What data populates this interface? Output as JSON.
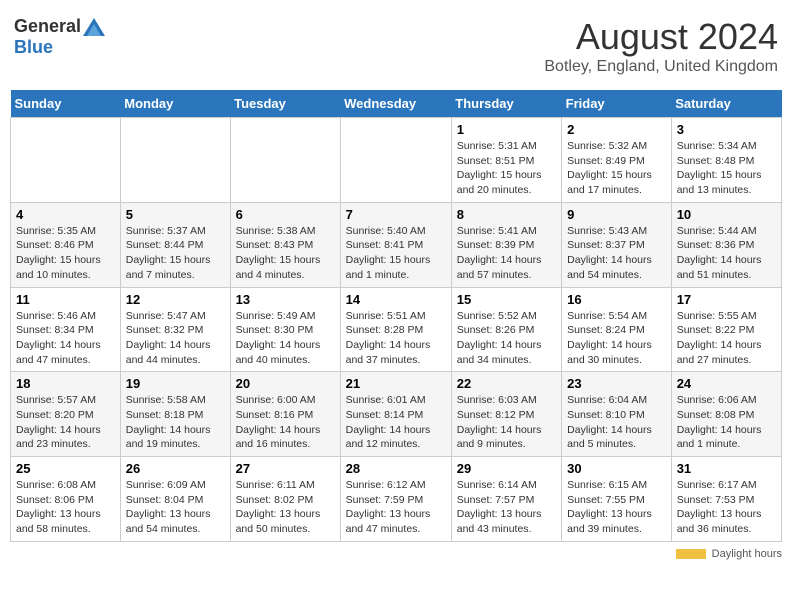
{
  "header": {
    "logo_general": "General",
    "logo_blue": "Blue",
    "title": "August 2024",
    "subtitle": "Botley, England, United Kingdom"
  },
  "days_of_week": [
    "Sunday",
    "Monday",
    "Tuesday",
    "Wednesday",
    "Thursday",
    "Friday",
    "Saturday"
  ],
  "weeks": [
    {
      "days": [
        {
          "number": "",
          "info": ""
        },
        {
          "number": "",
          "info": ""
        },
        {
          "number": "",
          "info": ""
        },
        {
          "number": "",
          "info": ""
        },
        {
          "number": "1",
          "info": "Sunrise: 5:31 AM\nSunset: 8:51 PM\nDaylight: 15 hours\nand 20 minutes."
        },
        {
          "number": "2",
          "info": "Sunrise: 5:32 AM\nSunset: 8:49 PM\nDaylight: 15 hours\nand 17 minutes."
        },
        {
          "number": "3",
          "info": "Sunrise: 5:34 AM\nSunset: 8:48 PM\nDaylight: 15 hours\nand 13 minutes."
        }
      ]
    },
    {
      "days": [
        {
          "number": "4",
          "info": "Sunrise: 5:35 AM\nSunset: 8:46 PM\nDaylight: 15 hours\nand 10 minutes."
        },
        {
          "number": "5",
          "info": "Sunrise: 5:37 AM\nSunset: 8:44 PM\nDaylight: 15 hours\nand 7 minutes."
        },
        {
          "number": "6",
          "info": "Sunrise: 5:38 AM\nSunset: 8:43 PM\nDaylight: 15 hours\nand 4 minutes."
        },
        {
          "number": "7",
          "info": "Sunrise: 5:40 AM\nSunset: 8:41 PM\nDaylight: 15 hours\nand 1 minute."
        },
        {
          "number": "8",
          "info": "Sunrise: 5:41 AM\nSunset: 8:39 PM\nDaylight: 14 hours\nand 57 minutes."
        },
        {
          "number": "9",
          "info": "Sunrise: 5:43 AM\nSunset: 8:37 PM\nDaylight: 14 hours\nand 54 minutes."
        },
        {
          "number": "10",
          "info": "Sunrise: 5:44 AM\nSunset: 8:36 PM\nDaylight: 14 hours\nand 51 minutes."
        }
      ]
    },
    {
      "days": [
        {
          "number": "11",
          "info": "Sunrise: 5:46 AM\nSunset: 8:34 PM\nDaylight: 14 hours\nand 47 minutes."
        },
        {
          "number": "12",
          "info": "Sunrise: 5:47 AM\nSunset: 8:32 PM\nDaylight: 14 hours\nand 44 minutes."
        },
        {
          "number": "13",
          "info": "Sunrise: 5:49 AM\nSunset: 8:30 PM\nDaylight: 14 hours\nand 40 minutes."
        },
        {
          "number": "14",
          "info": "Sunrise: 5:51 AM\nSunset: 8:28 PM\nDaylight: 14 hours\nand 37 minutes."
        },
        {
          "number": "15",
          "info": "Sunrise: 5:52 AM\nSunset: 8:26 PM\nDaylight: 14 hours\nand 34 minutes."
        },
        {
          "number": "16",
          "info": "Sunrise: 5:54 AM\nSunset: 8:24 PM\nDaylight: 14 hours\nand 30 minutes."
        },
        {
          "number": "17",
          "info": "Sunrise: 5:55 AM\nSunset: 8:22 PM\nDaylight: 14 hours\nand 27 minutes."
        }
      ]
    },
    {
      "days": [
        {
          "number": "18",
          "info": "Sunrise: 5:57 AM\nSunset: 8:20 PM\nDaylight: 14 hours\nand 23 minutes."
        },
        {
          "number": "19",
          "info": "Sunrise: 5:58 AM\nSunset: 8:18 PM\nDaylight: 14 hours\nand 19 minutes."
        },
        {
          "number": "20",
          "info": "Sunrise: 6:00 AM\nSunset: 8:16 PM\nDaylight: 14 hours\nand 16 minutes."
        },
        {
          "number": "21",
          "info": "Sunrise: 6:01 AM\nSunset: 8:14 PM\nDaylight: 14 hours\nand 12 minutes."
        },
        {
          "number": "22",
          "info": "Sunrise: 6:03 AM\nSunset: 8:12 PM\nDaylight: 14 hours\nand 9 minutes."
        },
        {
          "number": "23",
          "info": "Sunrise: 6:04 AM\nSunset: 8:10 PM\nDaylight: 14 hours\nand 5 minutes."
        },
        {
          "number": "24",
          "info": "Sunrise: 6:06 AM\nSunset: 8:08 PM\nDaylight: 14 hours\nand 1 minute."
        }
      ]
    },
    {
      "days": [
        {
          "number": "25",
          "info": "Sunrise: 6:08 AM\nSunset: 8:06 PM\nDaylight: 13 hours\nand 58 minutes."
        },
        {
          "number": "26",
          "info": "Sunrise: 6:09 AM\nSunset: 8:04 PM\nDaylight: 13 hours\nand 54 minutes."
        },
        {
          "number": "27",
          "info": "Sunrise: 6:11 AM\nSunset: 8:02 PM\nDaylight: 13 hours\nand 50 minutes."
        },
        {
          "number": "28",
          "info": "Sunrise: 6:12 AM\nSunset: 7:59 PM\nDaylight: 13 hours\nand 47 minutes."
        },
        {
          "number": "29",
          "info": "Sunrise: 6:14 AM\nSunset: 7:57 PM\nDaylight: 13 hours\nand 43 minutes."
        },
        {
          "number": "30",
          "info": "Sunrise: 6:15 AM\nSunset: 7:55 PM\nDaylight: 13 hours\nand 39 minutes."
        },
        {
          "number": "31",
          "info": "Sunrise: 6:17 AM\nSunset: 7:53 PM\nDaylight: 13 hours\nand 36 minutes."
        }
      ]
    }
  ],
  "footer": {
    "daylight_label": "Daylight hours"
  }
}
